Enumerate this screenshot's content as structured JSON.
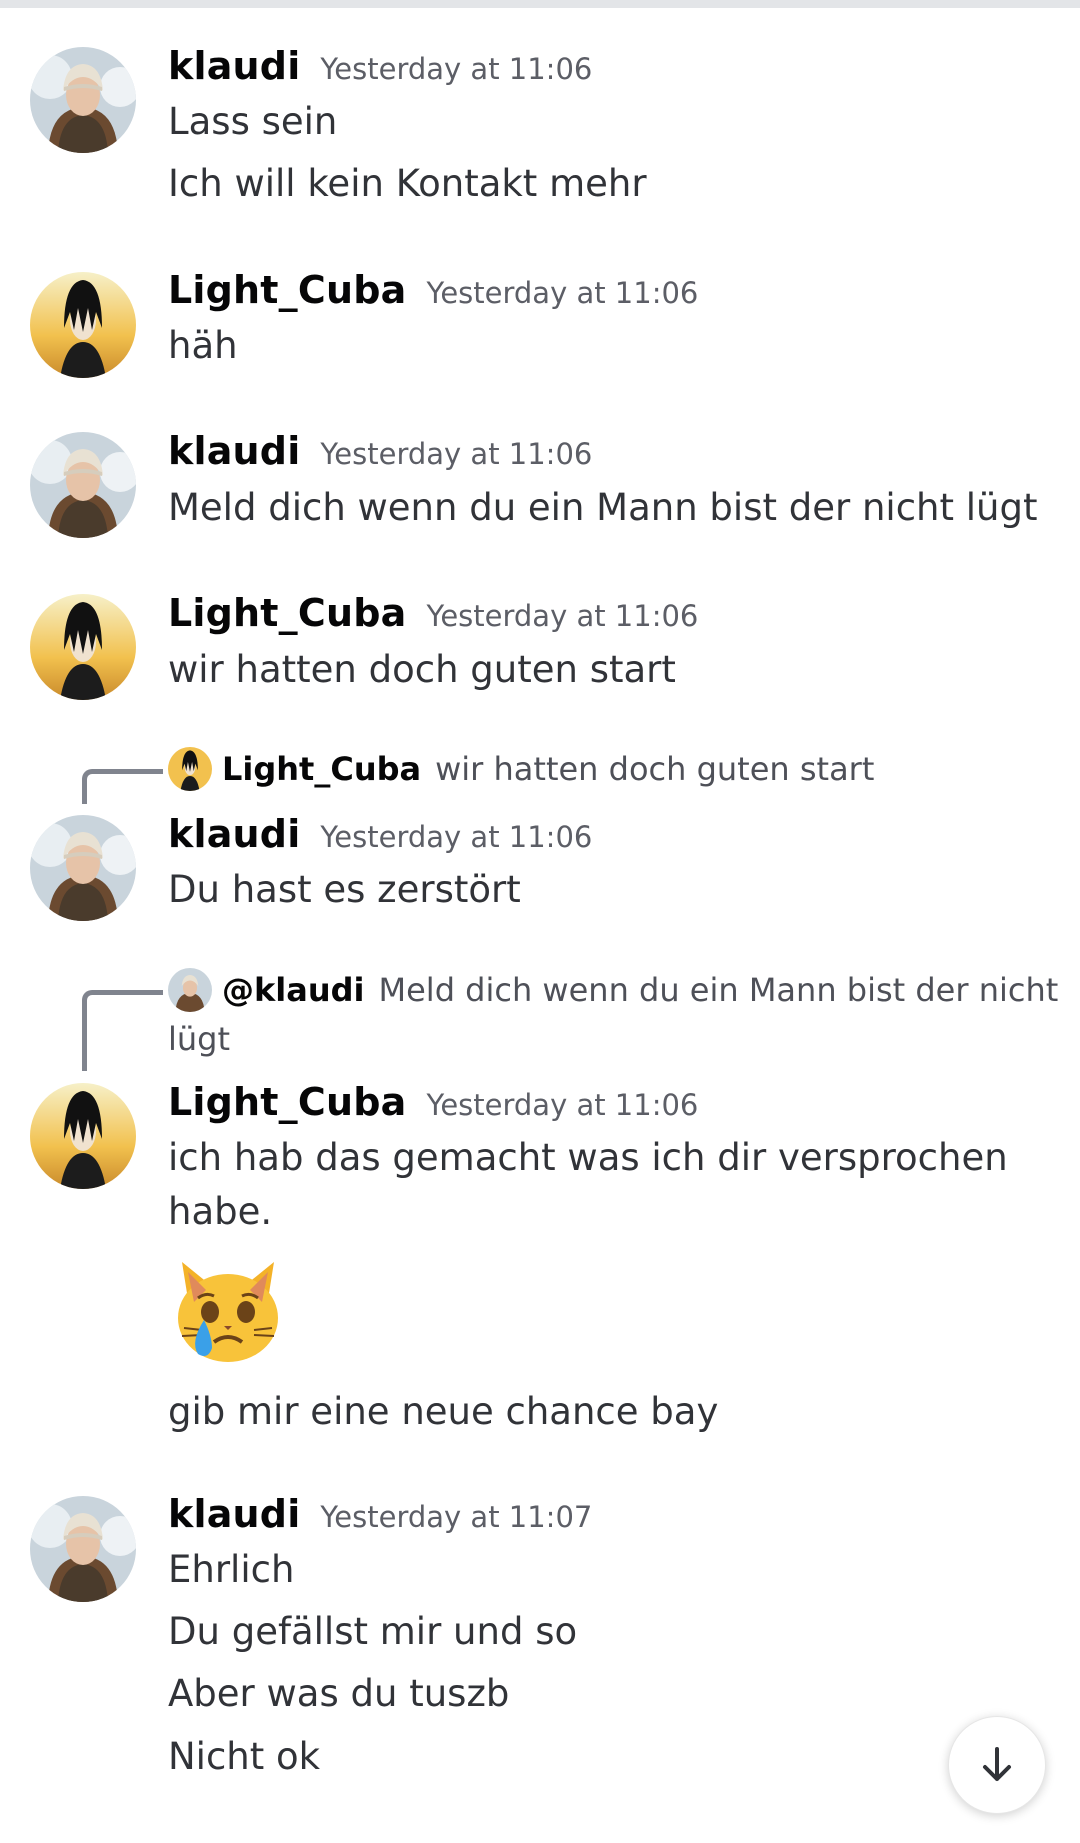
{
  "messages": [
    {
      "author": "klaudi",
      "time": "Yesterday at 11:06",
      "lines": [
        "Lass sein",
        "Ich will kein Kontakt mehr"
      ]
    },
    {
      "author": "Light_Cuba",
      "time": "Yesterday at 11:06",
      "lines": [
        "häh"
      ]
    },
    {
      "author": "klaudi",
      "time": "Yesterday at 11:06",
      "lines": [
        "Meld dich wenn du ein Mann bist der nicht lügt"
      ]
    },
    {
      "author": "Light_Cuba",
      "time": "Yesterday at 11:06",
      "lines": [
        "wir hatten doch guten start"
      ]
    },
    {
      "author": "klaudi",
      "time": "Yesterday at 11:06",
      "lines": [
        "Du hast es zerstört"
      ],
      "reply": {
        "name": "Light_Cuba",
        "text": "wir hatten doch guten start"
      }
    },
    {
      "author": "Light_Cuba",
      "time": "Yesterday at 11:06",
      "lines": [
        "ich hab das gemacht was ich dir versprochen",
        "habe.",
        "gib mir eine neue chance bay"
      ],
      "emoji": "crying-cat-face",
      "reply": {
        "name": "@klaudi",
        "text": "Meld dich wenn du ein Mann bist der nicht",
        "text_cont": "lügt"
      }
    },
    {
      "author": "klaudi",
      "time": "Yesterday at 11:07",
      "lines": [
        "Ehrlich",
        "Du gefällst mir und so",
        "Aber was du tuszb",
        "Nicht ok"
      ]
    }
  ],
  "jump_button": {
    "icon": "arrow-down-icon"
  },
  "colors": {
    "username": "#060607",
    "timestamp": "#5c5e66",
    "text": "#313338",
    "reply_line": "#80848e"
  }
}
